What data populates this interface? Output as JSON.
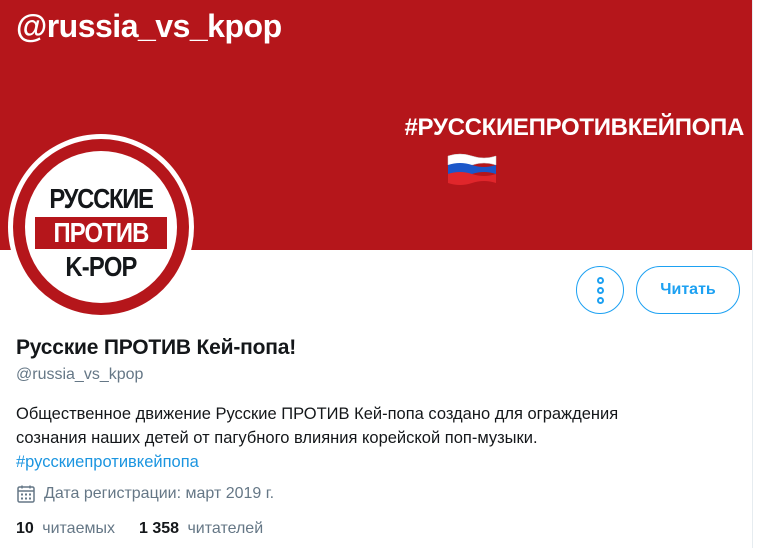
{
  "banner": {
    "handle": "@russia_vs_kpop",
    "hashtag": "#РУССКИЕПРОТИВКЕЙПОПА",
    "flag_icon": "russian-flag-icon",
    "background_color": "#b5161b"
  },
  "avatar": {
    "line1": "РУССКИЕ",
    "line2": "ПРОТИВ",
    "line3": "K-POP"
  },
  "actions": {
    "more_icon": "more-vertical-icon",
    "follow_label": "Читать"
  },
  "profile": {
    "name": "Русские ПРОТИВ Кей-попа!",
    "screen_name": "@russia_vs_kpop",
    "bio_line1": "Общественное движение Русские ПРОТИВ Кей-попа создано для ограждения",
    "bio_line2": "сознания наших детей от пагубного влияния корейской поп-музыки.",
    "bio_hashtag": "#русскиепротивкейпопа",
    "joined_icon": "calendar-icon",
    "joined_text": "Дата регистрации: март 2019 г."
  },
  "stats": {
    "following_count": "10",
    "following_label": "читаемых",
    "followers_count": "1 358",
    "followers_label": "читателей"
  },
  "colors": {
    "accent": "#1da1f2",
    "link": "#1b95e0",
    "secondary_text": "#657786",
    "brand_red": "#b5161b"
  }
}
